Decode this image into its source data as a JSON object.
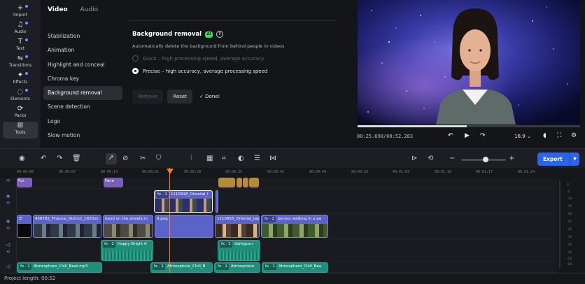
{
  "rail": [
    {
      "label": "Import",
      "icon": "plus-icon"
    },
    {
      "label": "Audio",
      "icon": "music-note-icon"
    },
    {
      "label": "Text",
      "icon": "text-icon"
    },
    {
      "label": "Transitions",
      "icon": "transitions-icon"
    },
    {
      "label": "Effects",
      "icon": "effects-icon"
    },
    {
      "label": "Elements",
      "icon": "elements-icon"
    },
    {
      "label": "Packs",
      "icon": "packs-icon"
    },
    {
      "label": "Tools",
      "icon": "tools-icon",
      "active": true
    }
  ],
  "panel": {
    "tabs": [
      {
        "label": "Video",
        "active": true
      },
      {
        "label": "Audio"
      }
    ],
    "menu": [
      "Stabilization",
      "Animation",
      "Highlight and conceal",
      "Chroma key",
      "Background removal",
      "Scene detection",
      "Logo",
      "Slow motion"
    ],
    "active_menu": "Background removal",
    "content": {
      "title": "Background removal",
      "badge": "AI",
      "description": "Automatically delete the background from behind people in videos",
      "option_quick": "Quick – high processing speed, average accuracy",
      "option_precise": "Precise – high accuracy, average processing speed",
      "remove_label": "Remove",
      "reset_label": "Reset",
      "done_label": "Done!"
    }
  },
  "preview": {
    "time": "00:25.690/00:52.283",
    "progress": 0.49,
    "ratio": "16:9"
  },
  "toolbar": {
    "export_label": "Export"
  },
  "ruler": [
    "00:00:00",
    "00:00:07",
    "00:00:14",
    "00:00:21",
    "00:00:28",
    "00:00:35",
    "00:00:42",
    "00:00:49",
    "00:00:56",
    "00:01:03",
    "00:01:10",
    "00:01:17",
    "00:01:24"
  ],
  "tracks": {
    "text_clips": [
      "For",
      "Faıre"
    ],
    "overlay_clip": "1110918_Oriental_I",
    "main_clips": [
      "458782_Finance_District_1920x1",
      "band on the streets.m",
      "9.png",
      "1110955_Oriental_Jap",
      "person walking in a pa"
    ],
    "overlay_audio": [
      "Happy Bright A",
      "dialogue.r"
    ],
    "music_clips": [
      "Atmosphere_Chill_Beat.mp3",
      "Atmosphere_Chill_B",
      "Atmosphere",
      "Atmosphere_Chill_Bea"
    ],
    "fx_tags": [
      "fx · 1",
      "fx · 2"
    ]
  },
  "meter_labels": [
    "0",
    "-5",
    "-10",
    "-15",
    "-20",
    "-25",
    "-30",
    "-35",
    "-40",
    "-45",
    "-50",
    "-60"
  ],
  "status": "Project length: 00:52"
}
